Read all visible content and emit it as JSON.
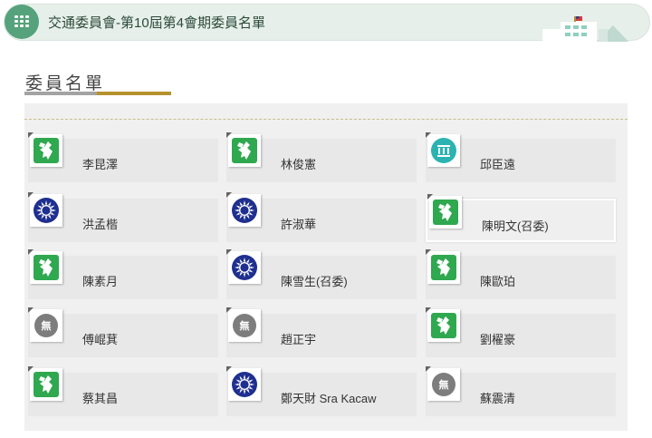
{
  "header": {
    "title": "交通委員會-第10屆第4會期委員名單"
  },
  "section": {
    "title": "委員名單"
  },
  "colors": {
    "dpp": "#2fa84f",
    "kmt": "#1e2f8f",
    "tpp": "#2ab3b1",
    "independent": "#7d7d7d",
    "accent_gold": "#b6922e",
    "header_green": "#55a27c"
  },
  "members": [
    {
      "name": "李昆澤",
      "party_icon": "dpp-icon"
    },
    {
      "name": "林俊憲",
      "party_icon": "dpp-icon"
    },
    {
      "name": "邱臣遠",
      "party_icon": "tpp-icon"
    },
    {
      "name": "洪孟楷",
      "party_icon": "kmt-icon"
    },
    {
      "name": "許淑華",
      "party_icon": "kmt-icon"
    },
    {
      "name": "陳明文(召委)",
      "party_icon": "dpp-icon"
    },
    {
      "name": "陳素月",
      "party_icon": "dpp-icon"
    },
    {
      "name": "陳雪生(召委)",
      "party_icon": "kmt-icon"
    },
    {
      "name": "陳歐珀",
      "party_icon": "dpp-icon"
    },
    {
      "name": "傅崐萁",
      "party_icon": "independent-icon",
      "badge": "無"
    },
    {
      "name": "趙正宇",
      "party_icon": "independent-icon",
      "badge": "無"
    },
    {
      "name": "劉櫂豪",
      "party_icon": "dpp-icon"
    },
    {
      "name": "蔡其昌",
      "party_icon": "dpp-icon"
    },
    {
      "name": "鄭天財 Sra Kacaw",
      "party_icon": "kmt-icon"
    },
    {
      "name": "蘇震清",
      "party_icon": "independent-icon",
      "badge": "無"
    }
  ]
}
